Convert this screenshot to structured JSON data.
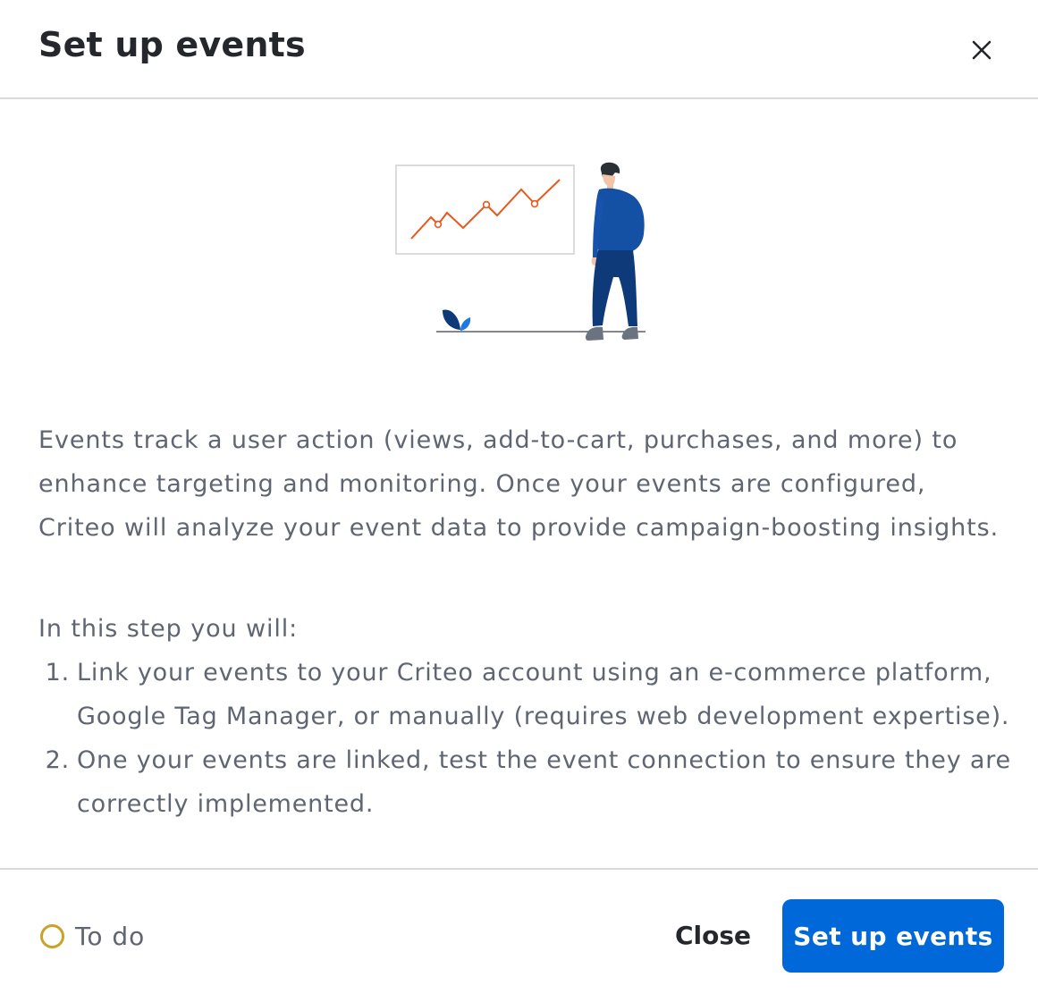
{
  "header": {
    "title": "Set up events",
    "close_icon": "close-icon"
  },
  "illustration": {
    "icon": "analytics-person-illustration",
    "colors": {
      "line": "#e8581c",
      "person": "#1450a3",
      "pants": "#0e3a7a",
      "leaf_dark": "#0e3a7a",
      "leaf_light": "#1f7ae0"
    }
  },
  "main": {
    "description": "Events track a user action (views, add-to-cart, purchases, and more) to enhance targeting and monitoring. Once your events are configured, Criteo will analyze your event data to provide campaign-boosting insights.",
    "steps_intro": "In this step you will:",
    "steps": [
      {
        "number": "1.",
        "text": "Link your events to your Criteo account using an e-commerce platform, Google Tag Manager, or manually (requires web development expertise)."
      },
      {
        "number": "2.",
        "text": "One your events are linked, test the event connection to ensure they are correctly implemented."
      }
    ]
  },
  "footer": {
    "status_label": "To do",
    "status_icon": "status-ring-icon",
    "close_label": "Close",
    "primary_label": "Set up events"
  },
  "colors": {
    "primary": "#0068d9",
    "status_todo": "#c9a227",
    "divider": "#d8dadd"
  }
}
